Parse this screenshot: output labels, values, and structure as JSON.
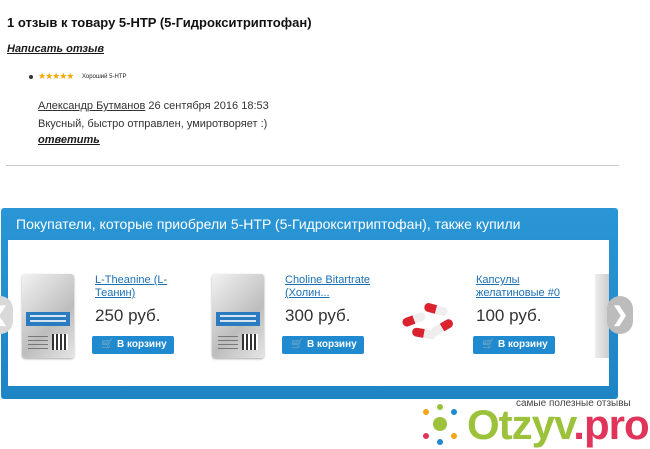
{
  "reviews_section": {
    "title": "1 отзыв к товару 5-HTP (5-Гидрокситриптофан)",
    "write_review": "Написать отзыв"
  },
  "review": {
    "stars": "★★★★★",
    "rating_label": "Хороший 5-HTP",
    "rating": 5,
    "author": "Александр Бутманов",
    "date": "26 сентября 2016 18:53",
    "text": "Вкусный, быстро отправлен, умиротворяет :)",
    "reply": "ответить"
  },
  "also_bought": {
    "title": "Покупатели, которые приобрели 5-HTP (5-Гидрокситриптофан), также купили",
    "products": [
      {
        "name_line1": "L-Theanine (L-",
        "name_line2": "Теанин)",
        "price": "250 руб.",
        "cart": "В корзину"
      },
      {
        "name_line1": "Choline Bitartrate",
        "name_line2": "(Холин...",
        "price": "300 руб.",
        "cart": "В корзину"
      },
      {
        "name_line1": "Капсулы",
        "name_line2": "желатиновые #0",
        "price": "100 руб.",
        "cart": "В корзину"
      }
    ],
    "prev_arrow": "❮",
    "next_arrow": "❯"
  },
  "watermark": {
    "caption": "самые полезные отзывы",
    "logo_main": "Otzyv",
    "logo_dot": ".",
    "logo_tld": "pro"
  },
  "colors": {
    "panel_blue": "#1f8ad0",
    "link_blue": "#1a6fb3",
    "star": "#f0a800",
    "logo_green": "#9bc23a",
    "logo_red": "#e0345a"
  }
}
